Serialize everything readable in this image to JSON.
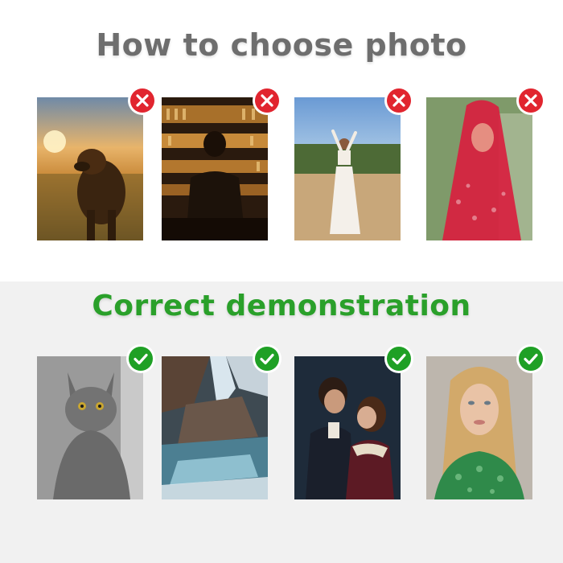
{
  "bad_section": {
    "title": "How to choose photo",
    "title_color": "#6e6e6e",
    "mark_color": "#e1252f",
    "photos": [
      {
        "subject": "dog-in-sunset-field",
        "mark": "cross-icon"
      },
      {
        "subject": "man-at-dark-bar",
        "mark": "cross-icon"
      },
      {
        "subject": "woman-in-white-outdoors",
        "mark": "cross-icon"
      },
      {
        "subject": "woman-with-red-veil",
        "mark": "cross-icon"
      }
    ]
  },
  "good_section": {
    "title": "Correct demonstration",
    "title_color": "#2aa02a",
    "mark_color": "#1fa025",
    "photos": [
      {
        "subject": "grey-cat-portrait",
        "mark": "checkmark-icon"
      },
      {
        "subject": "waterfall-rocks",
        "mark": "checkmark-icon"
      },
      {
        "subject": "couple-period-costume",
        "mark": "checkmark-icon"
      },
      {
        "subject": "blonde-woman-portrait",
        "mark": "checkmark-icon"
      }
    ]
  }
}
